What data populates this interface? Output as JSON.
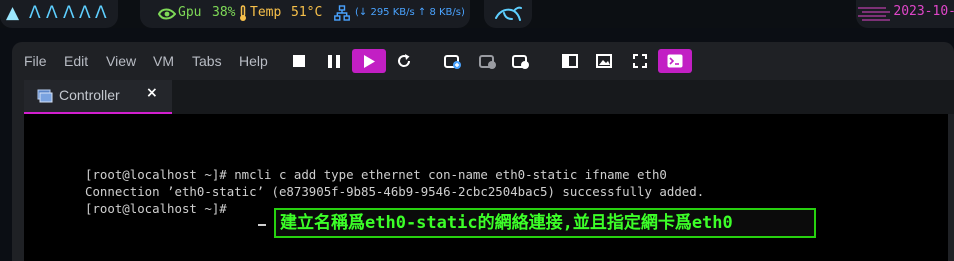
{
  "topbar": {
    "workspaces": [
      "▲",
      "Λ",
      "Λ",
      "Λ",
      "Λ",
      "Λ"
    ],
    "gpu_label": "Gpu",
    "gpu_value": "38%",
    "temp_label": "Temp",
    "temp_value": "51°C",
    "net_text": "(↓ 295 KB/s ↑ 8 KB/s)",
    "clock": "2023-10-",
    "colors": {
      "gpu": "#7ed957",
      "temp": "#f7c04a",
      "net": "#4aa3ff",
      "clock": "#e046c9",
      "workspace": "#5ecfff"
    }
  },
  "window": {
    "menu": [
      "File",
      "Edit",
      "View",
      "VM",
      "Tabs",
      "Help"
    ],
    "toolbar_icons": [
      "stop-icon",
      "pause-icon",
      "play-icon",
      "restart-icon",
      "snapshot-take-icon",
      "snapshot-revert-icon",
      "snapshot-manager-icon",
      "sidebar-toggle-icon",
      "thumbnail-icon",
      "fullscreen-icon",
      "console-icon"
    ],
    "tab": {
      "label": "Controller",
      "close": "×"
    }
  },
  "console": {
    "lines": [
      "[root@localhost ~]# nmcli c add type ethernet con-name eth0-static ifname eth0",
      "Connection ’eth0-static’ (e873905f-9b85-46b9-9546-2cbc2504bac5) successfully added.",
      "[root@localhost ~]# "
    ],
    "annotation": "建立名稱爲eth0-static的網絡連接,並且指定網卡爲eth0"
  }
}
